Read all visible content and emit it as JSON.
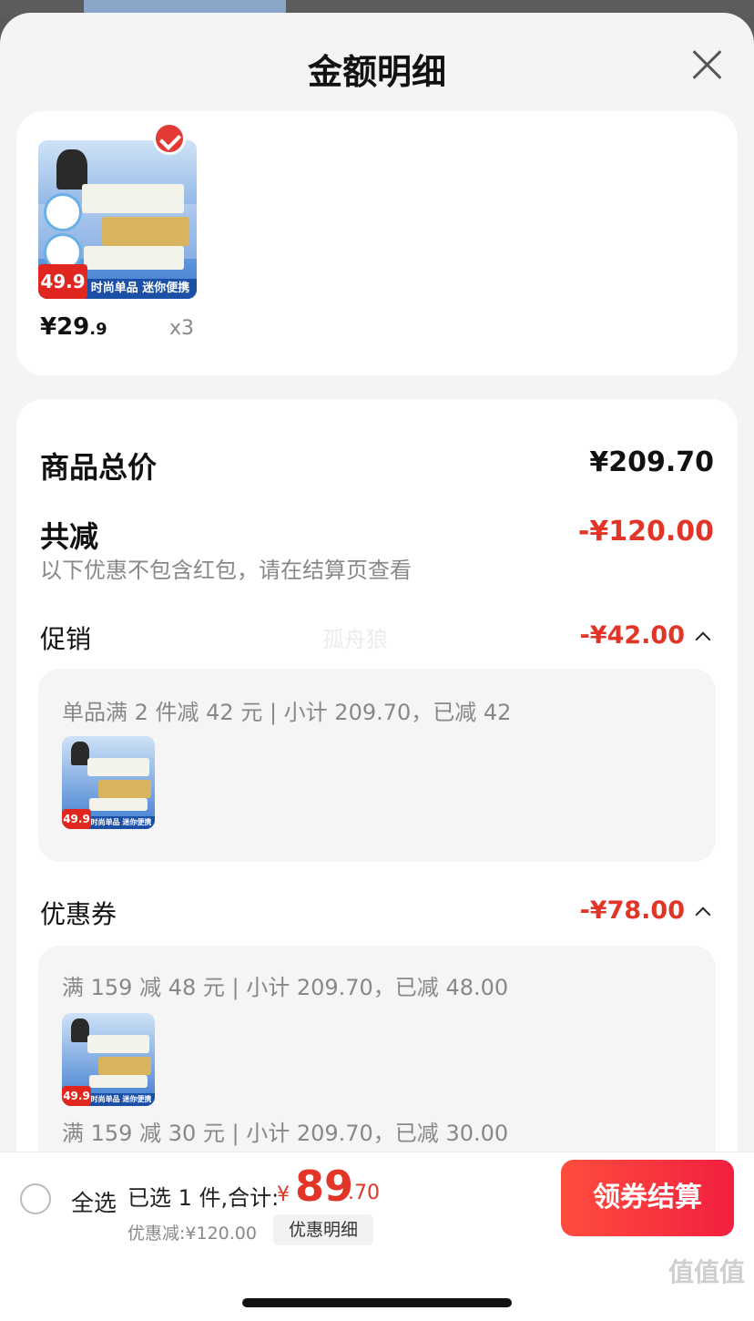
{
  "sheet": {
    "title": "金额明细"
  },
  "item": {
    "price_main": "¥29",
    "price_cents": ".9",
    "quantity": "x3"
  },
  "thumb": {
    "badge": "49.9",
    "banner": "时尚单品 迷你便携"
  },
  "summary": {
    "total_label": "商品总价",
    "total_value": "¥209.70",
    "reduce_label": "共减",
    "reduce_value": "-¥120.00",
    "note": "以下优惠不包含红包，请在结算页查看"
  },
  "promotion": {
    "label": "促销",
    "value": "-¥42.00",
    "detail": "单品满 2 件减 42 元 | 小计 209.70，已减 42"
  },
  "coupons": {
    "label": "优惠券",
    "value": "-¥78.00",
    "items": [
      "满 159 减 48 元 | 小计 209.70，已减 48.00",
      "满 159 减 30 元 | 小计 209.70，已减 30.00"
    ]
  },
  "bottom_bar": {
    "select_all": "全选",
    "selected_text": "已选 1 件,合计:",
    "currency": "¥",
    "total_int": "89",
    "total_dec": ".70",
    "discount": "优惠减:¥120.00",
    "detail_button": "优惠明细",
    "checkout_button": "领券结算"
  },
  "watermark": "孤舟狼",
  "site_logo": "值值值"
}
